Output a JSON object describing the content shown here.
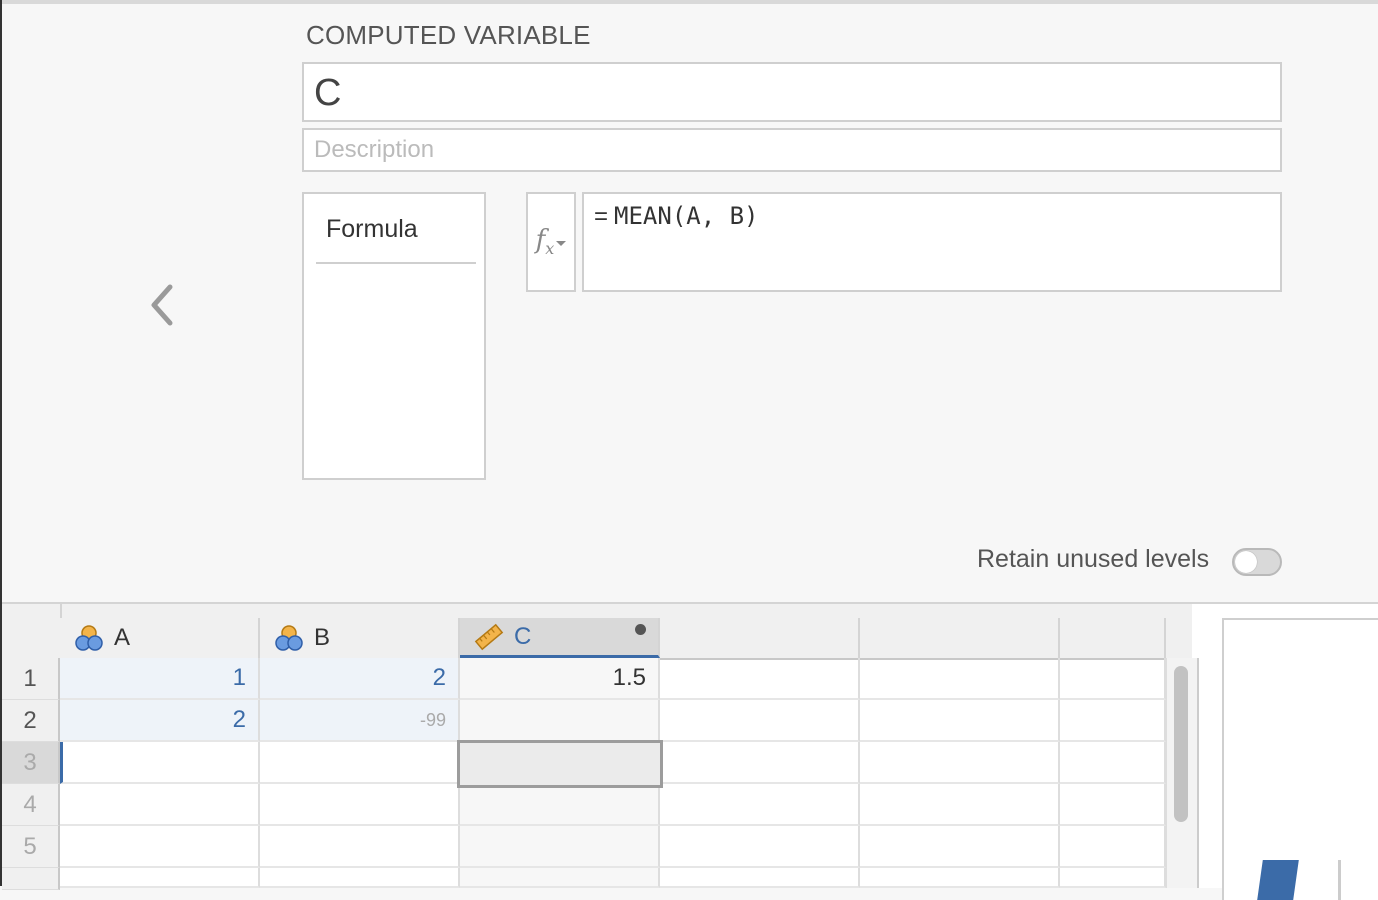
{
  "header": {
    "section_title": "COMPUTED VARIABLE"
  },
  "variable": {
    "name": "C",
    "description_placeholder": "Description"
  },
  "sidebar": {
    "items": [
      {
        "label": "Formula"
      }
    ]
  },
  "formula": {
    "equals": "=",
    "expression": "MEAN(A, B)",
    "function_button_icon": "fx-icon"
  },
  "retain": {
    "label": "Retain unused levels",
    "enabled": false
  },
  "spreadsheet": {
    "columns": [
      {
        "name": "A",
        "icon": "nominal-icon"
      },
      {
        "name": "B",
        "icon": "nominal-icon"
      },
      {
        "name": "C",
        "icon": "computed-ruler-icon",
        "selected": true
      }
    ],
    "row_numbers": [
      "1",
      "2",
      "3",
      "4",
      "5"
    ],
    "rows": [
      {
        "A": "1",
        "B": "2",
        "C": "1.5"
      },
      {
        "A": "2",
        "B": "-99",
        "C": ""
      }
    ]
  },
  "colors": {
    "accent": "#3b6ba8",
    "data_cell_bg": "#eef3f9"
  }
}
